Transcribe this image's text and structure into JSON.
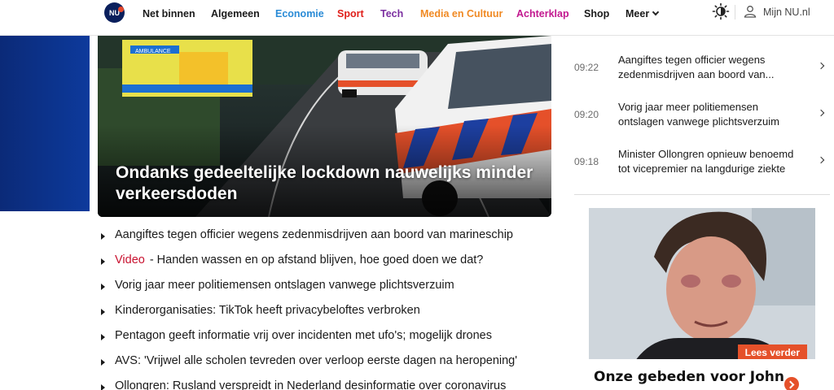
{
  "header": {
    "logo_text": "NU",
    "nav": [
      {
        "label": "Net binnen",
        "color": "#1a1a1a"
      },
      {
        "label": "Algemeen",
        "color": "#1a1a1a"
      },
      {
        "label": "Economie",
        "color": "#2a8bd6"
      },
      {
        "label": "Sport",
        "color": "#e0201b"
      },
      {
        "label": "Tech",
        "color": "#7b2fa0"
      },
      {
        "label": "Media en Cultuur",
        "color": "#f08a24"
      },
      {
        "label": "Achterklap",
        "color": "#c2188f"
      },
      {
        "label": "Shop",
        "color": "#1a1a1a"
      },
      {
        "label": "Meer",
        "color": "#1a1a1a"
      }
    ],
    "account_label": "Mijn NU.nl"
  },
  "hero": {
    "title": "Ondanks gedeeltelijke lockdown nauwelijks minder verkeersdoden",
    "ambulance_text": "AMBULANCE"
  },
  "articles": [
    {
      "prefix": "",
      "text": "Aangiftes tegen officier wegens zedenmisdrijven aan boord van marineschip"
    },
    {
      "prefix": "Video",
      "text": "- Handen wassen en op afstand blijven, hoe goed doen we dat?"
    },
    {
      "prefix": "",
      "text": "Vorig jaar meer politiemensen ontslagen vanwege plichtsverzuim"
    },
    {
      "prefix": "",
      "text": "Kinderorganisaties: TikTok heeft privacybeloftes verbroken"
    },
    {
      "prefix": "",
      "text": "Pentagon geeft informatie vrij over incidenten met ufo's; mogelijk drones"
    },
    {
      "prefix": "",
      "text": "AVS: 'Vrijwel alle scholen tevreden over verloop eerste dagen na heropening'"
    },
    {
      "prefix": "",
      "text": "Ollongren: Rusland verspreidt in Nederland desinformatie over coronavirus"
    }
  ],
  "latest": [
    {
      "time": "09:22",
      "line1": "Aangiftes tegen officier wegens",
      "line2": "zedenmisdrijven aan boord van..."
    },
    {
      "time": "09:20",
      "line1": "Vorig jaar meer politiemensen",
      "line2": "ontslagen vanwege plichtsverzuim"
    },
    {
      "time": "09:18",
      "line1": "Minister Ollongren opnieuw benoemd",
      "line2": "tot vicepremier na langdurige ziekte"
    }
  ],
  "ad": {
    "badge": "Lees verder",
    "title": "Onze gebeden voor John"
  },
  "colors": {
    "brand_navy": "#0a1f5c",
    "accent_orange": "#e5512a",
    "video_red": "#c8102e"
  }
}
